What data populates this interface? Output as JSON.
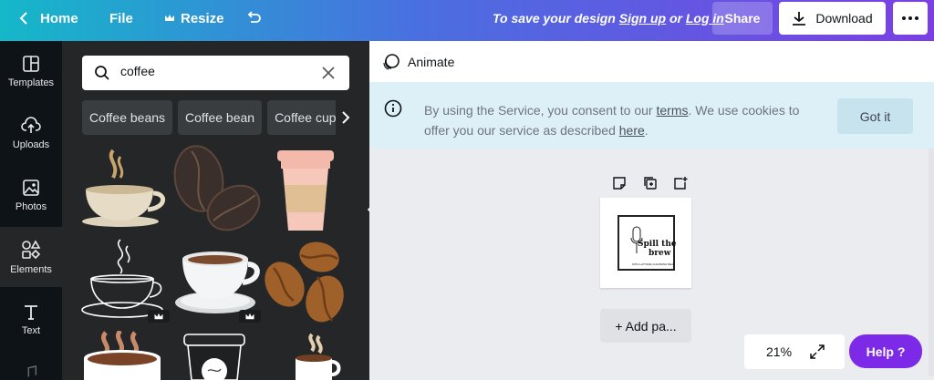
{
  "topbar": {
    "home_label": "Home",
    "file_label": "File",
    "resize_label": "Resize",
    "save_prefix": "To save your design",
    "sign_up": "Sign up",
    "or": "or",
    "log_in": "Log in",
    "share_label": "Share",
    "download_label": "Download",
    "icons": [
      "chevron-left-icon",
      "crown-icon",
      "undo-icon",
      "download-icon",
      "more-icon"
    ]
  },
  "sidebar": {
    "items": [
      {
        "label": "Templates",
        "icon": "templates-icon"
      },
      {
        "label": "Uploads",
        "icon": "upload-cloud-icon"
      },
      {
        "label": "Photos",
        "icon": "photo-icon"
      },
      {
        "label": "Elements",
        "icon": "shapes-icon",
        "active": true
      },
      {
        "label": "Text",
        "icon": "text-icon"
      }
    ]
  },
  "panel": {
    "search_value": "coffee",
    "chips": [
      "Coffee beans",
      "Coffee bean",
      "Coffee cup"
    ],
    "results": [
      {
        "name": "coffee-cup-steam-element"
      },
      {
        "name": "coffee-beans-sketch-element"
      },
      {
        "name": "takeaway-cup-element"
      },
      {
        "name": "line-art-cup-element",
        "premium": true
      },
      {
        "name": "white-cup-element",
        "premium": true
      },
      {
        "name": "brown-beans-element"
      },
      {
        "name": "hot-drink-mug-element"
      },
      {
        "name": "paper-cup-element"
      },
      {
        "name": "small-mug-element"
      }
    ]
  },
  "workspace": {
    "animate_label": "Animate",
    "cookie": {
      "text_1": "By using the Service, you consent to our",
      "terms": "terms",
      "text_2": ". We use cookies to offer you our service as described",
      "here": "here",
      "text_3": ".",
      "button": "Got it"
    },
    "page_logo": {
      "line1": "Spill the",
      "line2": "brew",
      "line3": "WITH LATTADE CHANNING BEAL"
    },
    "add_page_label": "+ Add pa...",
    "zoom_value": "21%",
    "help_label": "Help ?"
  },
  "colors": {
    "gradient_start": "#14b8c9",
    "gradient_end": "#7b3fe4",
    "help_purple": "#7d2ae8",
    "cookie_bg": "#ddf0f8"
  }
}
